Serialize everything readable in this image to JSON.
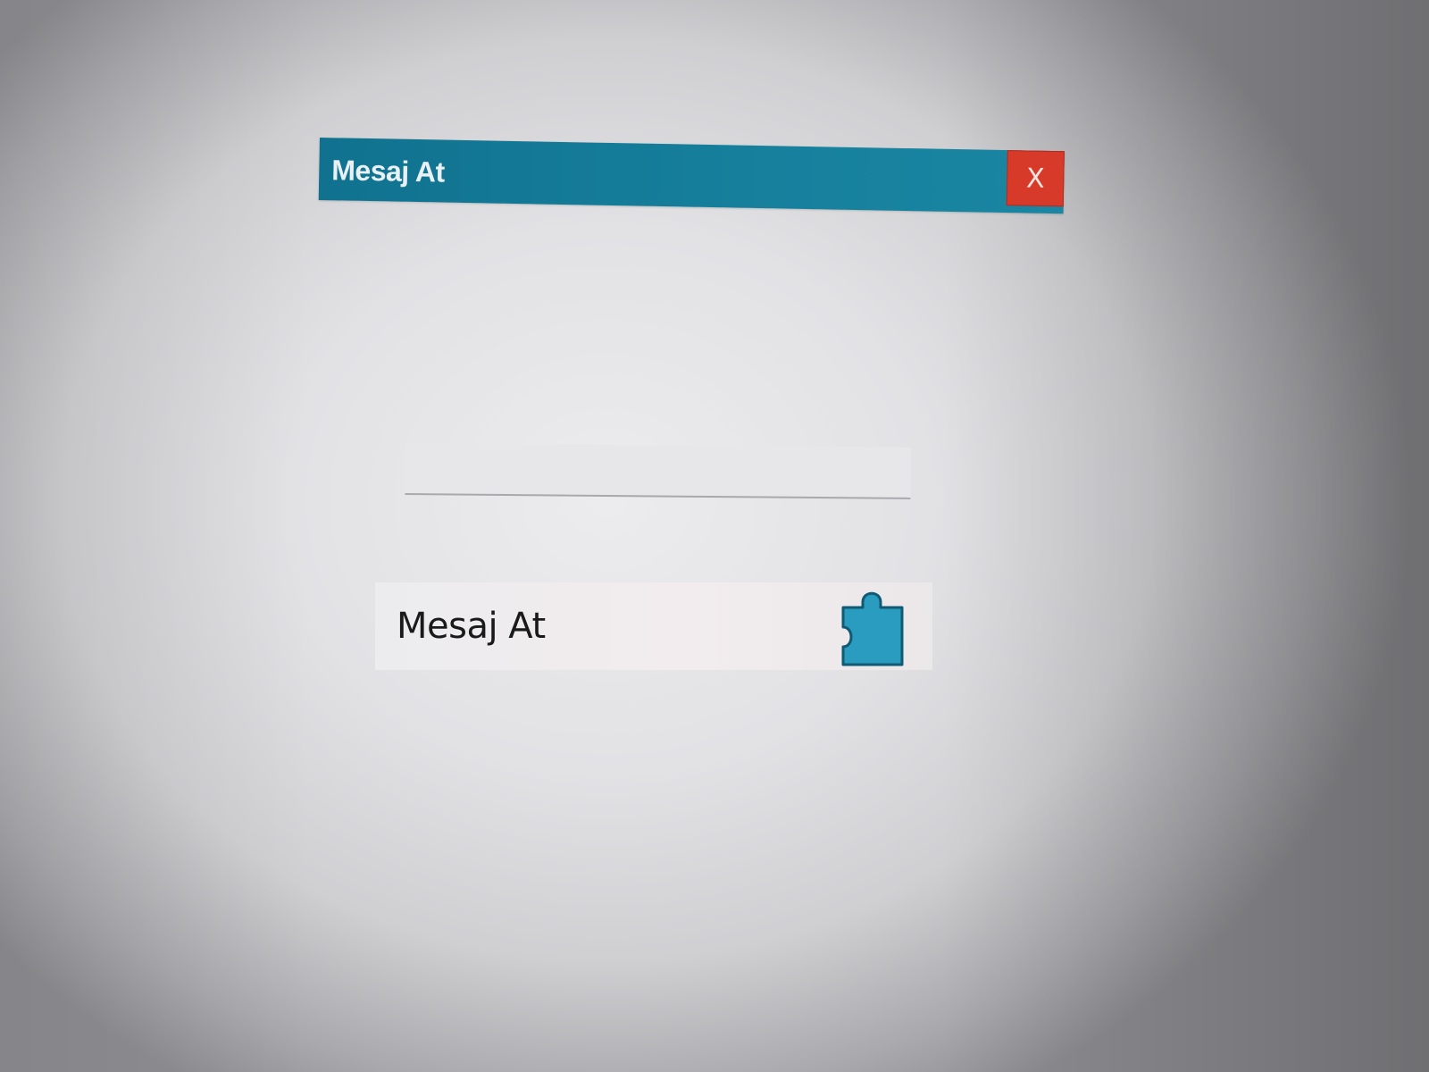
{
  "window": {
    "title": "Mesaj At",
    "close_label": "X"
  },
  "message_input": {
    "value": "",
    "placeholder": ""
  },
  "send_button": {
    "label": "Mesaj At",
    "icon": "puzzle-icon"
  },
  "colors": {
    "titlebar": "#13789a",
    "close": "#d83a2a",
    "icon": "#2a9cc0"
  }
}
